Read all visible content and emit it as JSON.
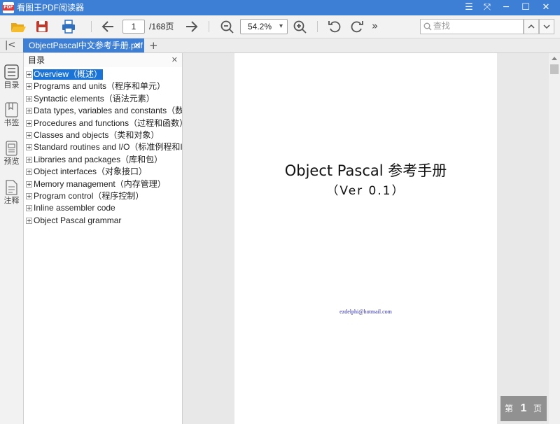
{
  "window": {
    "title": "看图王PDF阅读器",
    "logo_text": "PDF",
    "controls": {
      "menu": "☰",
      "restore_down": "⤧",
      "minimize": "─",
      "maximize": "☐",
      "close": "✕"
    }
  },
  "toolbar": {
    "icons": [
      "open-folder-icon",
      "save-icon",
      "print-icon",
      "previous-page-icon",
      "next-page-icon",
      "zoom-out-icon",
      "zoom-in-icon",
      "rotate-left-icon",
      "rotate-right-icon",
      "more-icon"
    ],
    "page_number": "1",
    "page_total": "/168页",
    "zoom_value": "54.2%",
    "zoom_dropdown_glyph": "▾",
    "more_glyph": "»",
    "search_placeholder": "查找",
    "search_prev_glyph": "▲",
    "search_next_glyph": "▼"
  },
  "tabs": {
    "collapse_glyph": "|<",
    "active_tab": "ObjectPascal中文参考手册.pdf",
    "close_glyph": "✕",
    "new_tab_glyph": "+"
  },
  "rail": {
    "items": [
      {
        "label": "目录",
        "icon": "outline-icon"
      },
      {
        "label": "书签",
        "icon": "bookmark-icon"
      },
      {
        "label": "预览",
        "icon": "thumbnail-icon"
      },
      {
        "label": "注释",
        "icon": "annotation-icon"
      }
    ]
  },
  "outline": {
    "title": "目录",
    "close_glyph": "✕",
    "items": [
      "Overview（概述）",
      "Programs and units（程序和单元）",
      "Syntactic elements（语法元素）",
      "Data types, variables and constants（数据类",
      "Procedures and functions（过程和函数）",
      "Classes and objects（类和对象）",
      "Standard routines and I/O（标准例程和I/O）",
      "Libraries and packages（库和包）",
      "Object interfaces（对象接口）",
      "Memory management（内存管理）",
      "Program control（程序控制）",
      "Inline assembler code",
      "Object Pascal grammar"
    ],
    "selected_index": 0
  },
  "document": {
    "title": "Object Pascal 参考手册",
    "version": "（Ver 0.1）",
    "email": "ezdelphi@hotmail.com"
  },
  "page_indicator": {
    "prefix": "第",
    "number": "1",
    "suffix": "页"
  },
  "colors": {
    "accent": "#3e7fd6",
    "selection": "#1a73d6",
    "email_text": "#2a2aa0"
  }
}
